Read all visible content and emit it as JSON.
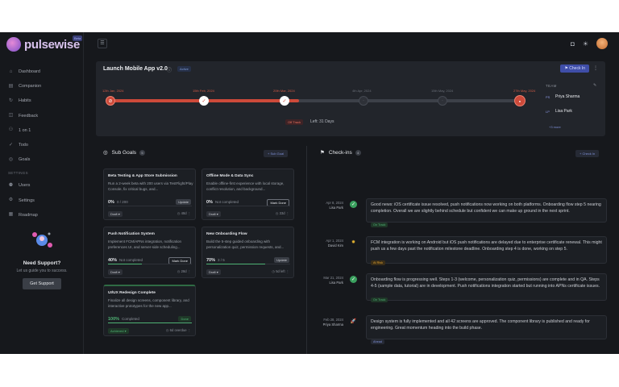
{
  "brand": {
    "name": "pulsewise",
    "badge": "Beta"
  },
  "nav": {
    "items": [
      {
        "label": "Dashboard",
        "icon": "home-icon",
        "glyph": "⌂"
      },
      {
        "label": "Companion",
        "icon": "book-icon",
        "glyph": "▤"
      },
      {
        "label": "Habits",
        "icon": "refresh-icon",
        "glyph": "↻"
      },
      {
        "label": "Feedback",
        "icon": "chat-icon",
        "glyph": "◫"
      },
      {
        "label": "1 on 1",
        "icon": "users-icon",
        "glyph": "⚇"
      },
      {
        "label": "Todo",
        "icon": "check-icon",
        "glyph": "✓"
      },
      {
        "label": "Goals",
        "icon": "target-icon",
        "glyph": "◎"
      }
    ],
    "section": "SETTINGS",
    "settings": [
      {
        "label": "Users",
        "icon": "user-icon",
        "glyph": "⚉"
      },
      {
        "label": "Settings",
        "icon": "gear-icon",
        "glyph": "⚙"
      },
      {
        "label": "Roadmap",
        "icon": "map-icon",
        "glyph": "▦"
      }
    ]
  },
  "support": {
    "title": "Need Support?",
    "text": "Let us guide you to success.",
    "button": "Get Support"
  },
  "goal": {
    "title": "Launch Mobile App v2.0",
    "status": "Active",
    "checkin_label": "Check In",
    "today": "Off Track",
    "days_left": "Left: 31 Days",
    "milestones": [
      {
        "date": "12th Jan, 2024",
        "state": "red"
      },
      {
        "date": "15th Feb, 2024",
        "state": "white"
      },
      {
        "date": "20th Mar, 2024",
        "state": "white"
      },
      {
        "date": "4th Apr, 2024",
        "state": "grey"
      },
      {
        "date": "15th May, 2024",
        "state": "grey"
      },
      {
        "date": "27th May, 2024",
        "state": "end"
      }
    ],
    "team_label": "TEAM",
    "team": [
      {
        "initials": "PS",
        "name": "Priya Sharma"
      },
      {
        "initials": "LP",
        "name": "Lisa Park"
      }
    ],
    "team_view": "+3 more"
  },
  "subgoals": {
    "heading": "Sub Goals",
    "count": "5",
    "add_label": "+ Sub Goal",
    "items": [
      {
        "title": "Beta Testing & App Store Submission",
        "desc": "Run a 2-week beta with 200 users via TestFlight/Play Console, fix critical bugs, and...",
        "pct": "0%",
        "sub": "0 / 200",
        "action": "Update",
        "action_type": "update",
        "progress": 0,
        "status": "Draft",
        "meta": "◷ 48d"
      },
      {
        "title": "Offline Mode & Data Sync",
        "desc": "Enable offline-first experience with local storage, conflict resolution, and background...",
        "pct": "0%",
        "sub": "Not completed",
        "action": "Mark Done",
        "action_type": "mark",
        "progress": 0,
        "status": "Draft",
        "meta": "◷ 33d"
      },
      {
        "title": "Push Notification System",
        "desc": "Implement FCM/APNs integration, notification preferences UI, and server-side scheduling...",
        "pct": "40%",
        "sub": "Not completed",
        "action": "Mark Done",
        "action_type": "mark",
        "progress": 40,
        "status": "Draft",
        "meta": "◷ 28d"
      },
      {
        "title": "New Onboarding Flow",
        "desc": "Build the 5-step guided onboarding with personalization quiz, permission requests, and...",
        "pct": "70%",
        "sub": "3 / 5",
        "action": "Update",
        "action_type": "update",
        "progress": 70,
        "status": "Draft",
        "meta": "◷ 5d left"
      },
      {
        "title": "UI/UX Redesign Complete",
        "desc": "Finalize all design screens, component library, and interactive prototypes for the new app...",
        "pct": "100%",
        "sub": "Completed",
        "action": "Done",
        "action_type": "greenbtn",
        "progress": 100,
        "status": "Achieved",
        "meta": "◷ 6d overdue"
      }
    ]
  },
  "checkins": {
    "heading": "Check-ins",
    "count": "4",
    "add_label": "+ Check In",
    "items": [
      {
        "date": "Apr 8, 2024",
        "author": "Lisa Park",
        "icon": "on-track-icon",
        "kind": "ok",
        "glyph": "✓",
        "text": "Good news: iOS certificate issue resolved, push notifications now working on both platforms. Onboarding flow step 5 nearing completion. Overall we are slightly behind schedule but confident we can make up ground in the next sprint.",
        "tag": "On Track",
        "tag_type": "ontrack"
      },
      {
        "date": "Apr 1, 2024",
        "author": "David Kim",
        "icon": "at-risk-icon",
        "kind": "warn",
        "glyph": "✹",
        "text": "FCM integration is working on Android but iOS push notifications are delayed due to enterprise certificate renewal. This might push us a few days past the notification milestone deadline. Onboarding step 4 is done, working on step 5.",
        "tag": "At Risk",
        "tag_type": "risk"
      },
      {
        "date": "Mar 21, 2024",
        "author": "Lisa Park",
        "icon": "on-track-icon",
        "kind": "ok",
        "glyph": "✓",
        "text": "Onboarding flow is progressing well. Steps 1-3 (welcome, personalization quiz, permissions) are complete and in QA. Steps 4-5 (sample data, tutorial) are in development. Push notifications integration started but running into APNs certificate issues.",
        "tag": "On Track",
        "tag_type": "ontrack"
      },
      {
        "date": "Feb 28, 2024",
        "author": "Priya Sharma",
        "icon": "rocket-icon",
        "kind": "rocket",
        "glyph": "🚀",
        "text": "Design system is fully implemented and all 42 screens are approved. The component library is published and ready for engineering. Great momentum heading into the build phase.",
        "tag": "Ahead",
        "tag_type": "ahead"
      }
    ]
  }
}
